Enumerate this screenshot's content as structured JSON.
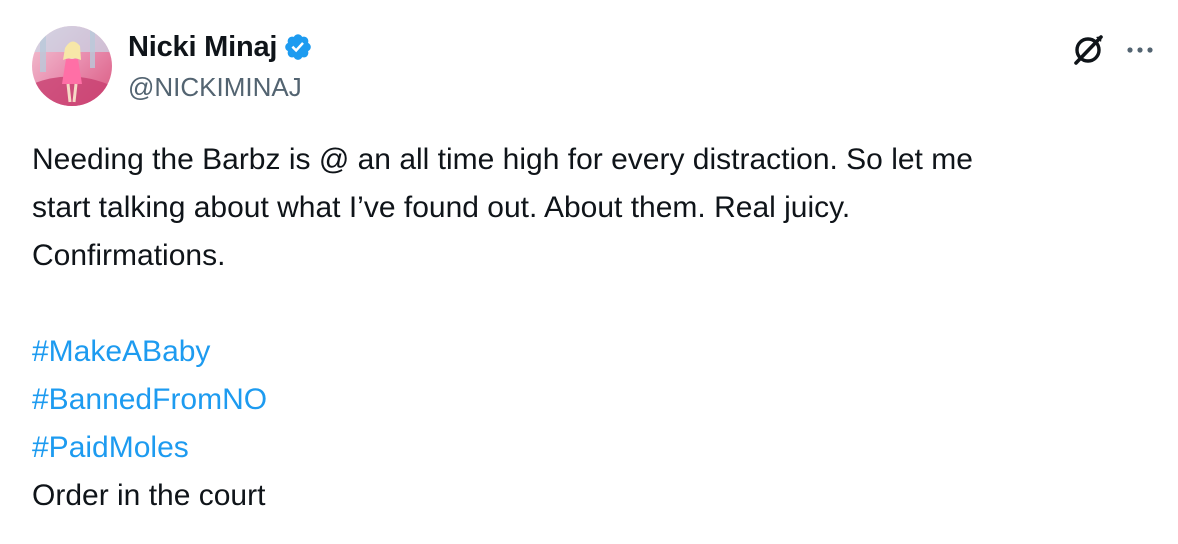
{
  "author": {
    "name": "Nicki Minaj",
    "handle": "@NICKIMINAJ",
    "verified_color": "#1d9bf0"
  },
  "icons": {
    "verified": "verified-badge-icon",
    "grok": "grok-icon",
    "more": "more-options-icon"
  },
  "tweet": {
    "lines": [
      "Needing the Barbz is @ an all time high for every distraction. So let me",
      "start talking about what I’ve found out. About them. Real juicy.",
      "Confirmations."
    ],
    "hashtags": [
      "#MakeABaby",
      "#BannedFromNO",
      "#PaidMoles"
    ],
    "closing": "Order in the court"
  },
  "colors": {
    "link": "#1d9bf0",
    "text": "#0f1419",
    "secondary": "#536471"
  }
}
